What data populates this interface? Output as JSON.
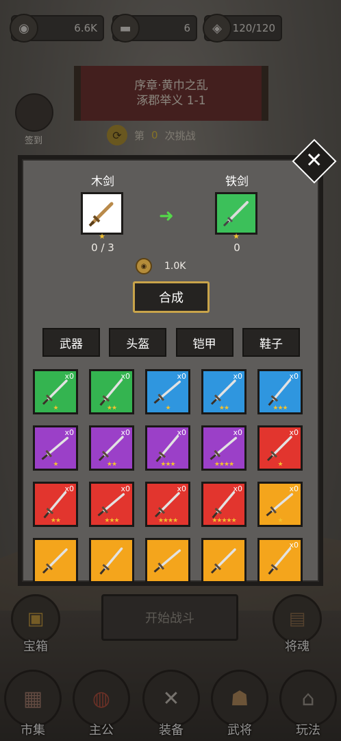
{
  "resources": {
    "coin": {
      "icon": "coin-icon",
      "value": "6.6K"
    },
    "ingot": {
      "icon": "ingot-icon",
      "value": "6"
    },
    "stamina": {
      "icon": "food-bag-icon",
      "value": "120/120"
    }
  },
  "chapter": {
    "line1": "序章·黄巾之乱",
    "line2": "涿郡举义 1-1"
  },
  "challenge": {
    "prefix": "第",
    "number": "0",
    "suffix": "次挑战"
  },
  "side": {
    "checkin_label": "签到"
  },
  "modal": {
    "from_item": {
      "name": "木剑",
      "count": "0 / 3",
      "stars": "★",
      "color": "#ffffff"
    },
    "to_item": {
      "name": "铁剑",
      "count": "0",
      "stars": "★",
      "color": "#3cc05a"
    },
    "cost": "1.0K",
    "combine_label": "合成",
    "tabs": [
      "武器",
      "头盔",
      "铠甲",
      "鞋子"
    ],
    "grid": [
      {
        "color": "#34b450",
        "qty": "x0",
        "stars": "★"
      },
      {
        "color": "#34b450",
        "qty": "x0",
        "stars": "★★"
      },
      {
        "color": "#2f96df",
        "qty": "x0",
        "stars": "★"
      },
      {
        "color": "#2f96df",
        "qty": "x0",
        "stars": "★★"
      },
      {
        "color": "#2f96df",
        "qty": "x0",
        "stars": "★★★"
      },
      {
        "color": "#9b40c8",
        "qty": "x0",
        "stars": "★"
      },
      {
        "color": "#9b40c8",
        "qty": "x0",
        "stars": "★★"
      },
      {
        "color": "#9b40c8",
        "qty": "x0",
        "stars": "★★★"
      },
      {
        "color": "#9b40c8",
        "qty": "x0",
        "stars": "★★★★"
      },
      {
        "color": "#e2352e",
        "qty": "x0",
        "stars": "★"
      },
      {
        "color": "#e2352e",
        "qty": "x0",
        "stars": "★★"
      },
      {
        "color": "#e2352e",
        "qty": "x0",
        "stars": "★★★"
      },
      {
        "color": "#e2352e",
        "qty": "x0",
        "stars": "★★★★"
      },
      {
        "color": "#e2352e",
        "qty": "x0",
        "stars": "★★★★★"
      },
      {
        "color": "#f4a51c",
        "qty": "x0",
        "stars": "★"
      },
      {
        "color": "#f4a51c",
        "qty": "",
        "stars": ""
      },
      {
        "color": "#f4a51c",
        "qty": "",
        "stars": ""
      },
      {
        "color": "#f4a51c",
        "qty": "",
        "stars": ""
      },
      {
        "color": "#f4a51c",
        "qty": "",
        "stars": ""
      },
      {
        "color": "#f4a51c",
        "qty": "x0",
        "stars": ""
      }
    ]
  },
  "start_battle_label": "开始战斗",
  "treasure_label": "宝箱",
  "general_soul_label": "将魂",
  "nav": [
    {
      "label": "市集",
      "icon": "market-icon"
    },
    {
      "label": "主公",
      "icon": "lord-icon"
    },
    {
      "label": "装备",
      "icon": "crossed-swords-icon"
    },
    {
      "label": "武将",
      "icon": "general-icon"
    },
    {
      "label": "玩法",
      "icon": "gate-icon"
    }
  ]
}
